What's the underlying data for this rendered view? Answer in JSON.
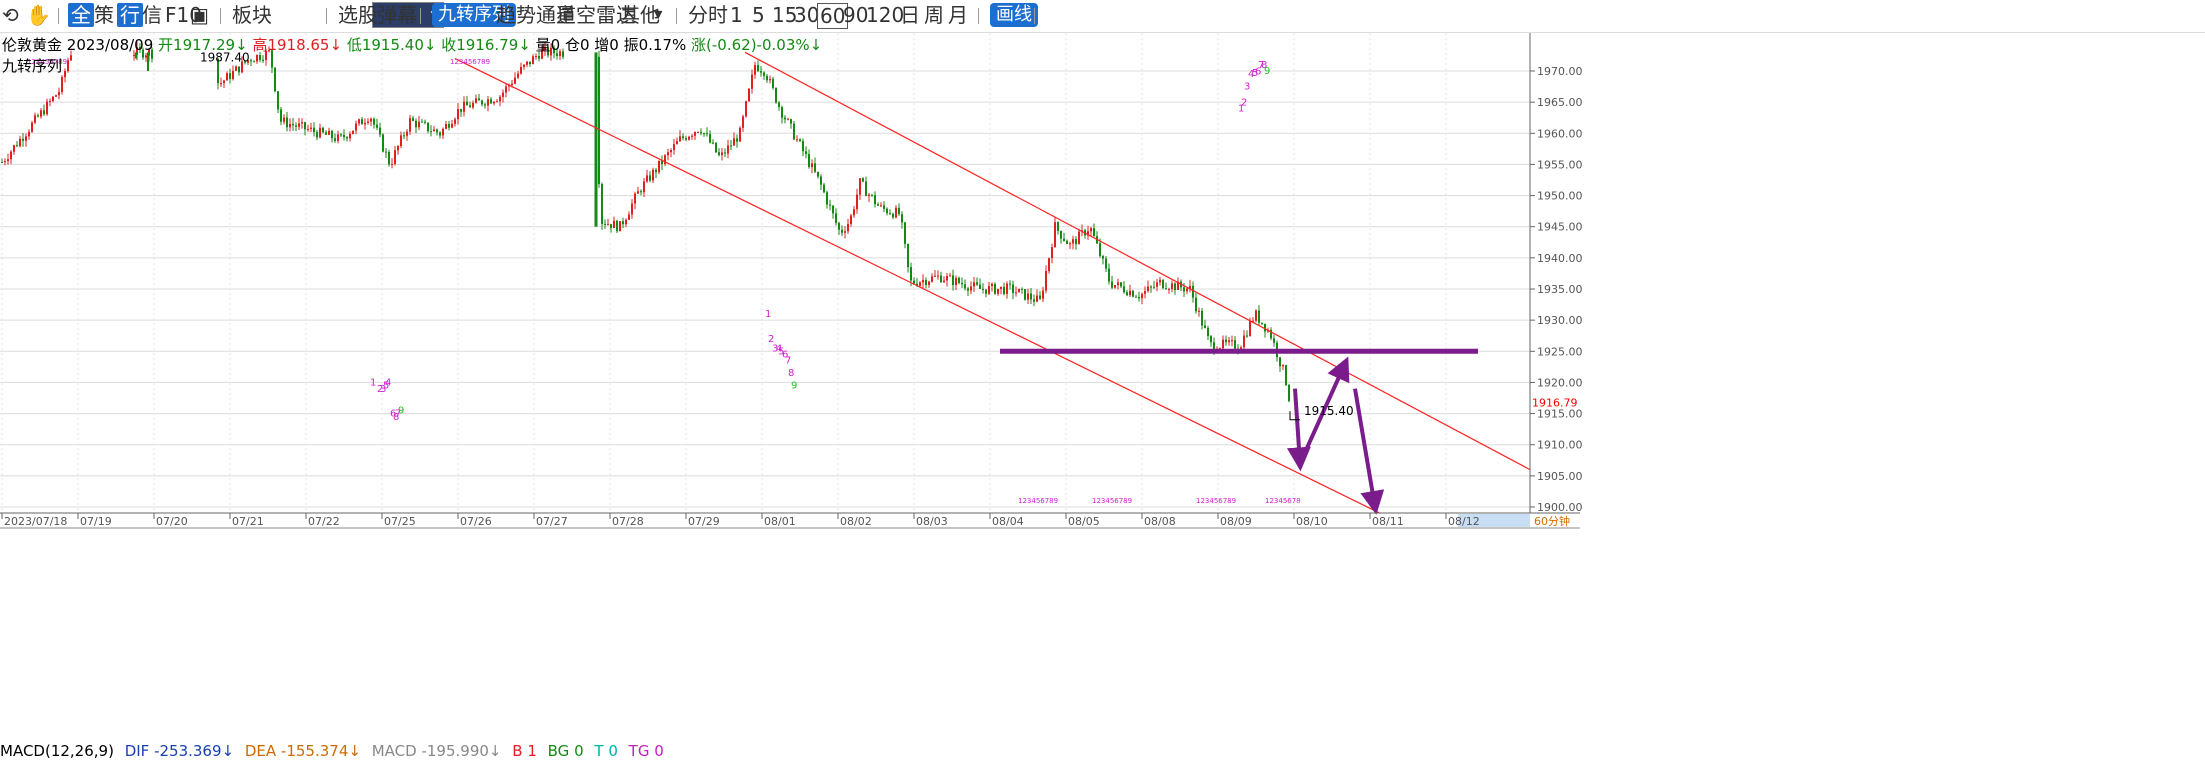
{
  "toolbar": {
    "items": [
      "全",
      "策",
      "行",
      "信",
      "F10",
      "板块",
      "选股",
      "弹幕",
      "九转序列",
      "趋势通道",
      "星空雷达",
      "其他",
      "分时",
      "1",
      "5",
      "15",
      "30",
      "60",
      "90",
      "120",
      "日",
      "周",
      "月",
      "画线"
    ]
  },
  "info": {
    "symbol": "伦敦黄金",
    "date": "2023/08/09",
    "open": "开1917.29↓",
    "high": "高1918.65↓",
    "low": "低1915.40↓",
    "close": "收1916.79↓",
    "volume": "量0",
    "position": "仓0",
    "increase": "增0",
    "amplitude": "振0.17%",
    "change": "涨(-0.62)-0.03%↓",
    "indicator": "九转序列"
  },
  "colors": {
    "up": "#e02020",
    "down": "#148a14",
    "channel": "#ff2020",
    "support": "#7b1c8c",
    "arrow": "#7b1c8c",
    "price_tag": "#ff0000"
  },
  "chart_data": {
    "type": "candlestick",
    "timeframe": "60分钟",
    "ylim": [
      1898,
      1974
    ],
    "y_ticks": [
      1900.0,
      1905.0,
      1910.0,
      1915.0,
      1920.0,
      1925.0,
      1930.0,
      1935.0,
      1940.0,
      1945.0,
      1950.0,
      1955.0,
      1960.0,
      1965.0,
      1970.0
    ],
    "y_tick_labels": [
      "1900.00",
      "1905.00",
      "1910.00",
      "1915.00",
      "1920.00",
      "1925.00",
      "1930.00",
      "1935.00",
      "1940.00",
      "1945.00",
      "1950.00",
      "1955.00",
      "1960.00",
      "1965.00",
      "1970.00"
    ],
    "x_labels": [
      "2023/07/18",
      "07/19",
      "07/20",
      "07/21",
      "07/22",
      "07/25",
      "07/26",
      "07/27",
      "07/28",
      "07/29",
      "08/01",
      "08/02",
      "08/03",
      "08/04",
      "08/05",
      "08/08",
      "08/09",
      "08/10",
      "08/11",
      "08/12"
    ],
    "x_label_suffix": "60分钟",
    "close_path": [
      [
        0,
        1955
      ],
      [
        60,
        1967
      ],
      [
        70,
        1973
      ],
      [
        135,
        1973
      ],
      [
        150,
        1973
      ],
      [
        220,
        1968
      ],
      [
        250,
        1972
      ],
      [
        270,
        1973
      ],
      [
        280,
        1962
      ],
      [
        300,
        1961
      ],
      [
        340,
        1959
      ],
      [
        370,
        1963
      ],
      [
        390,
        1955
      ],
      [
        410,
        1962
      ],
      [
        440,
        1960
      ],
      [
        460,
        1964
      ],
      [
        500,
        1966
      ],
      [
        520,
        1970
      ],
      [
        540,
        1973
      ],
      [
        560,
        1973
      ],
      [
        596,
        1973
      ],
      [
        600,
        1946
      ],
      [
        620,
        1945
      ],
      [
        640,
        1951
      ],
      [
        660,
        1955
      ],
      [
        680,
        1959
      ],
      [
        700,
        1961
      ],
      [
        720,
        1956
      ],
      [
        740,
        1960
      ],
      [
        755,
        1971
      ],
      [
        765,
        1970
      ],
      [
        780,
        1964
      ],
      [
        800,
        1958
      ],
      [
        820,
        1952
      ],
      [
        840,
        1944
      ],
      [
        850,
        1946
      ],
      [
        860,
        1952
      ],
      [
        880,
        1948
      ],
      [
        900,
        1947
      ],
      [
        910,
        1936
      ],
      [
        940,
        1937
      ],
      [
        980,
        1935
      ],
      [
        1010,
        1935
      ],
      [
        1040,
        1933
      ],
      [
        1055,
        1945
      ],
      [
        1070,
        1942
      ],
      [
        1090,
        1945
      ],
      [
        1110,
        1936
      ],
      [
        1140,
        1934
      ],
      [
        1160,
        1936
      ],
      [
        1190,
        1935
      ],
      [
        1210,
        1926
      ],
      [
        1240,
        1926
      ],
      [
        1255,
        1931
      ],
      [
        1270,
        1928
      ],
      [
        1285,
        1921
      ],
      [
        1290,
        1916.79
      ]
    ],
    "channel_upper": [
      [
        745,
        1973
      ],
      [
        1530,
        1906
      ]
    ],
    "channel_lower": [
      [
        455,
        1972
      ],
      [
        1380,
        1899
      ]
    ],
    "support_level": {
      "value": 1925.0,
      "x_from": 1000,
      "x_to": 1478
    },
    "low_annotation": "1915.40",
    "high_annotation": "1987.40",
    "last_price": "1916.79",
    "projection_path": [
      [
        1295,
        1919
      ],
      [
        1300,
        1907
      ],
      [
        1345,
        1923
      ],
      [
        1355,
        1919
      ],
      [
        1375,
        1900
      ]
    ],
    "td_markers": [
      {
        "x": 370,
        "y": 1919.5,
        "t": "1"
      },
      {
        "x": 385,
        "y": 1919.5,
        "t": "4"
      },
      {
        "x": 377,
        "y": 1918.5,
        "t": "2"
      },
      {
        "x": 380,
        "y": 1918.5,
        "t": "3"
      },
      {
        "x": 383,
        "y": 1919,
        "t": "5"
      },
      {
        "x": 390,
        "y": 1914.5,
        "t": "6"
      },
      {
        "x": 395,
        "y": 1914.5,
        "t": "7"
      },
      {
        "x": 393,
        "y": 1914,
        "t": "8"
      },
      {
        "x": 398,
        "y": 1915,
        "t": "9"
      },
      {
        "x": 765,
        "y": 1930.5,
        "t": "1"
      },
      {
        "x": 768,
        "y": 1926.5,
        "t": "2"
      },
      {
        "x": 772,
        "y": 1925,
        "t": "3"
      },
      {
        "x": 776,
        "y": 1925,
        "t": "4"
      },
      {
        "x": 778,
        "y": 1924.5,
        "t": "5"
      },
      {
        "x": 782,
        "y": 1924,
        "t": "6"
      },
      {
        "x": 785,
        "y": 1923,
        "t": "7"
      },
      {
        "x": 788,
        "y": 1921,
        "t": "8"
      },
      {
        "x": 791,
        "y": 1919,
        "t": "9"
      },
      {
        "x": 1238,
        "y": 1963.5,
        "t": "1"
      },
      {
        "x": 1241,
        "y": 1964.5,
        "t": "2"
      },
      {
        "x": 1244,
        "y": 1967,
        "t": "3"
      },
      {
        "x": 1248,
        "y": 1969,
        "t": "4"
      },
      {
        "x": 1252,
        "y": 1969.2,
        "t": "5"
      },
      {
        "x": 1255,
        "y": 1969.4,
        "t": "6"
      },
      {
        "x": 1258,
        "y": 1970.5,
        "t": "7"
      },
      {
        "x": 1261,
        "y": 1970.5,
        "t": "8"
      },
      {
        "x": 1264,
        "y": 1969.5,
        "t": "9"
      }
    ],
    "td_rows": [
      {
        "x": 27,
        "t": "123456789"
      },
      {
        "x": 450,
        "t": "123456789"
      },
      {
        "x": 1018,
        "t": "123456789"
      },
      {
        "x": 1092,
        "t": "123456789"
      },
      {
        "x": 1196,
        "t": "123456789"
      },
      {
        "x": 1265,
        "t": "12345678"
      }
    ]
  },
  "macd": {
    "name": "MACD(12,26,9)",
    "dif": "DIF -253.369↓",
    "dea": "DEA -155.374↓",
    "macd": "MACD -195.990↓",
    "b": "B 1",
    "bg": "BG 0",
    "t": "T 0",
    "tg": "TG 0"
  }
}
